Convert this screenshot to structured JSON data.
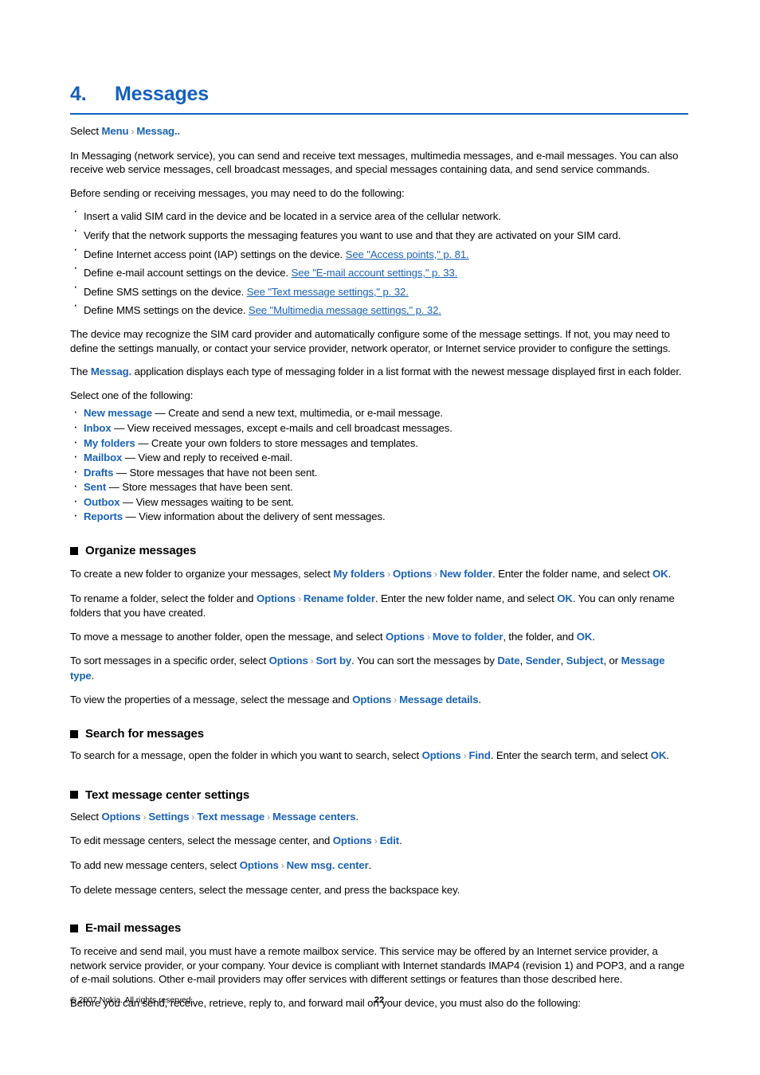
{
  "document": {
    "chapter_number": "4.",
    "chapter_title": "Messages"
  },
  "intro": {
    "select_label": "Select",
    "select_menu": "Menu",
    "select_app": "Messag..",
    "para1": "In Messaging (network service), you can send and receive text messages, multimedia messages, and e-mail messages. You can also receive web service messages, cell broadcast messages, and special messages containing data, and send service commands.",
    "para2": "Before sending or receiving messages, you may need to do the following:",
    "prereqs": [
      {
        "text": "Insert a valid SIM card in the device and be located in a service area of the cellular network.",
        "ref": ""
      },
      {
        "text": "Verify that the network supports the messaging features you want to use and that they are activated on your SIM card.",
        "ref": ""
      },
      {
        "text": "Define Internet access point (IAP) settings on the device. ",
        "ref": "See \"Access points,\" p. 81."
      },
      {
        "text": "Define e-mail account settings on the device. ",
        "ref": "See \"E-mail account settings,\" p. 33."
      },
      {
        "text": "Define SMS settings on the device. ",
        "ref": "See \"Text message settings,\" p. 32."
      },
      {
        "text": "Define MMS settings on the device. ",
        "ref": "See \"Multimedia message settings,\" p. 32."
      }
    ],
    "para3": "The device may recognize the SIM card provider and automatically configure some of the message settings. If not, you may need to define the settings manually, or contact your service provider, network operator, or Internet service provider to configure the settings.",
    "para4_pre": "The ",
    "para4_link": "Messag.",
    "para4_post": " application displays each type of messaging folder in a list format with the newest message displayed first in each folder.",
    "para5": "Select one of the following:",
    "folders": [
      {
        "name": "New message",
        "desc": " — Create and send a new text, multimedia, or e-mail message."
      },
      {
        "name": "Inbox",
        "desc": " — View received messages, except e-mails and cell broadcast messages."
      },
      {
        "name": "My folders",
        "desc": " — Create your own folders to store messages and templates."
      },
      {
        "name": "Mailbox",
        "desc": " — View and reply to received e-mail."
      },
      {
        "name": "Drafts",
        "desc": " — Store messages that have not been sent."
      },
      {
        "name": "Sent",
        "desc": " — Store messages that have been sent."
      },
      {
        "name": "Outbox",
        "desc": " — View messages waiting to be sent."
      },
      {
        "name": "Reports",
        "desc": " — View information about the delivery of sent messages."
      }
    ]
  },
  "organize": {
    "heading": "Organize messages",
    "create": {
      "t1": "To create a new folder to organize your messages, select ",
      "l1": "My folders",
      "l2": "Options",
      "l3": "New folder",
      "t2": ". Enter the folder name, and select ",
      "l4": "OK",
      "t3": "."
    },
    "rename": {
      "t1": "To rename a folder, select the folder and ",
      "l1": "Options",
      "l2": "Rename folder",
      "t2": ". Enter the new folder name, and select ",
      "l3": "OK",
      "t3": ". You can only rename folders that you have created."
    },
    "move": {
      "t1": "To move a message to another folder, open the message, and select ",
      "l1": "Options",
      "l2": "Move to folder",
      "t2": ", the folder, and ",
      "l3": "OK",
      "t3": "."
    },
    "sort": {
      "t1": "To sort messages in a specific order, select ",
      "l1": "Options",
      "l2": "Sort by",
      "t2": ". You can sort the messages by ",
      "l3": "Date",
      "t3": ", ",
      "l4": "Sender",
      "t4": ", ",
      "l5": "Subject",
      "t5": ", or ",
      "l6": "Message type",
      "t6": "."
    },
    "properties": {
      "t1": "To view the properties of a message, select the message and ",
      "l1": "Options",
      "l2": "Message details",
      "t2": "."
    }
  },
  "search": {
    "heading": "Search for messages",
    "body": {
      "t1": "To search for a message, open the folder in which you want to search, select ",
      "l1": "Options",
      "l2": "Find",
      "t2": ". Enter the search term, and select ",
      "l3": "OK",
      "t3": "."
    }
  },
  "center": {
    "heading": "Text message center settings",
    "select": {
      "t1": "Select ",
      "l1": "Options",
      "l2": "Settings",
      "l3": "Text message",
      "l4": "Message centers",
      "t2": "."
    },
    "edit": {
      "t1": "To edit message centers, select the message center, and ",
      "l1": "Options",
      "l2": "Edit",
      "t2": "."
    },
    "add": {
      "t1": "To add new message centers, select ",
      "l1": "Options",
      "l2": "New msg. center",
      "t2": "."
    },
    "delete": "To delete message centers, select the message center, and press the backspace key."
  },
  "email": {
    "heading": "E-mail messages",
    "para1": "To receive and send mail, you must have a remote mailbox service. This service may be offered by an Internet service provider, a network service provider, or your company. Your device is compliant with Internet standards IMAP4 (revision 1) and POP3, and a range of e-mail solutions. Other e-mail providers may offer services with different settings or features than those described here.",
    "para2": "Before you can send, receive, retrieve, reply to, and forward mail on your device, you must also do the following:"
  },
  "footer": {
    "copyright": "© 2007 Nokia. All rights reserved.",
    "page_number": "22"
  },
  "colors": {
    "heading_blue": "#1560bd",
    "link_blue": "#1b62b5",
    "separator_grey": "#8894a4"
  }
}
